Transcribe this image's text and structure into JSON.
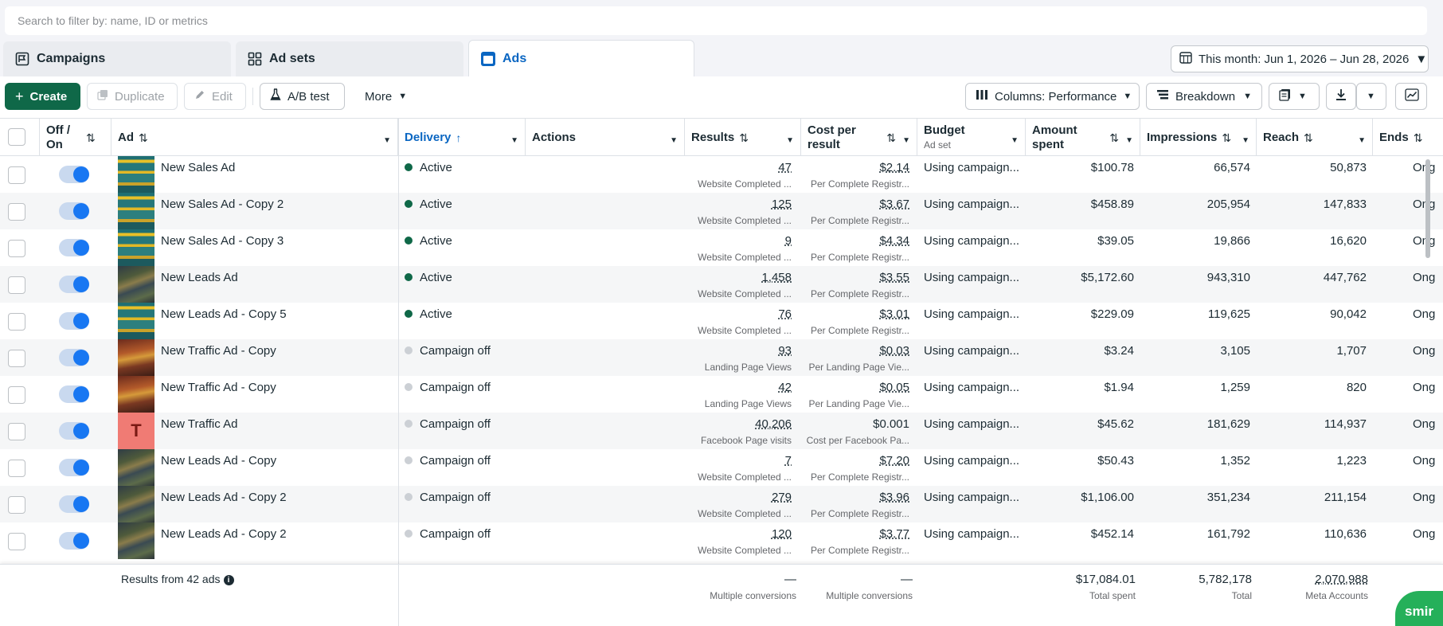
{
  "search": {
    "placeholder": "Search to filter by: name, ID or metrics"
  },
  "tabs": [
    {
      "label": "Campaigns",
      "icon": "flag-icon"
    },
    {
      "label": "Ad sets",
      "icon": "grid-icon"
    },
    {
      "label": "Ads",
      "icon": "ad-icon"
    }
  ],
  "date_range": {
    "label": "This month: Jun 1, 2026 – Jun 28, 2026"
  },
  "toolbar": {
    "create": "Create",
    "duplicate": "Duplicate",
    "edit": "Edit",
    "ab_test": "A/B test",
    "more": "More",
    "columns": "Columns: Performance",
    "breakdown": "Breakdown"
  },
  "columns": {
    "offon": "Off / On",
    "ad": "Ad",
    "delivery": "Delivery",
    "actions": "Actions",
    "results": "Results",
    "cost_per_result_1": "Cost per",
    "cost_per_result_2": "result",
    "budget": "Budget",
    "budget_sub": "Ad set",
    "amount_spent_1": "Amount",
    "amount_spent_2": "spent",
    "impressions": "Impressions",
    "reach": "Reach",
    "ends": "Ends"
  },
  "rows": [
    {
      "name": "New Sales Ad",
      "thumb": "teal",
      "delivery": "Active",
      "status": "on",
      "results": "47",
      "results_sub": "Website Completed ...",
      "cpr": "$2.14",
      "cpr_sub": "Per Complete Registr...",
      "budget": "Using campaign...",
      "spent": "$100.78",
      "impressions": "66,574",
      "reach": "50,873",
      "ends": "Ong"
    },
    {
      "name": "New Sales Ad - Copy 2",
      "thumb": "teal",
      "delivery": "Active",
      "status": "on",
      "results": "125",
      "results_sub": "Website Completed ...",
      "cpr": "$3.67",
      "cpr_sub": "Per Complete Registr...",
      "budget": "Using campaign...",
      "spent": "$458.89",
      "impressions": "205,954",
      "reach": "147,833",
      "ends": "Ong"
    },
    {
      "name": "New Sales Ad - Copy 3",
      "thumb": "teal",
      "delivery": "Active",
      "status": "on",
      "results": "9",
      "results_sub": "Website Completed ...",
      "cpr": "$4.34",
      "cpr_sub": "Per Complete Registr...",
      "budget": "Using campaign...",
      "spent": "$39.05",
      "impressions": "19,866",
      "reach": "16,620",
      "ends": "Ong"
    },
    {
      "name": "New Leads Ad",
      "thumb": "dark",
      "delivery": "Active",
      "status": "on",
      "results": "1,458",
      "results_sub": "Website Completed ...",
      "cpr": "$3.55",
      "cpr_sub": "Per Complete Registr...",
      "budget": "Using campaign...",
      "spent": "$5,172.60",
      "impressions": "943,310",
      "reach": "447,762",
      "ends": "Ong"
    },
    {
      "name": "New Leads Ad - Copy 5",
      "thumb": "teal",
      "delivery": "Active",
      "status": "on",
      "results": "76",
      "results_sub": "Website Completed ...",
      "cpr": "$3.01",
      "cpr_sub": "Per Complete Registr...",
      "budget": "Using campaign...",
      "spent": "$229.09",
      "impressions": "119,625",
      "reach": "90,042",
      "ends": "Ong"
    },
    {
      "name": "New Traffic Ad - Copy",
      "thumb": "red",
      "delivery": "Campaign off",
      "status": "off",
      "results": "93",
      "results_sub": "Landing Page Views",
      "cpr": "$0.03",
      "cpr_sub": "Per Landing Page Vie...",
      "budget": "Using campaign...",
      "spent": "$3.24",
      "impressions": "3,105",
      "reach": "1,707",
      "ends": "Ong"
    },
    {
      "name": "New Traffic Ad - Copy",
      "thumb": "red",
      "delivery": "Campaign off",
      "status": "off",
      "results": "42",
      "results_sub": "Landing Page Views",
      "cpr": "$0.05",
      "cpr_sub": "Per Landing Page Vie...",
      "budget": "Using campaign...",
      "spent": "$1.94",
      "impressions": "1,259",
      "reach": "820",
      "ends": "Ong"
    },
    {
      "name": "New Traffic Ad",
      "thumb": "letter",
      "thumb_letter": "T",
      "delivery": "Campaign off",
      "status": "off",
      "results": "40,206",
      "results_sub": "Facebook Page visits",
      "cpr": "$0.001",
      "cpr_sub": "Cost per Facebook Pa...",
      "budget": "Using campaign...",
      "spent": "$45.62",
      "impressions": "181,629",
      "reach": "114,937",
      "ends": "Ong"
    },
    {
      "name": "New Leads Ad - Copy",
      "thumb": "dark",
      "delivery": "Campaign off",
      "status": "off",
      "results": "7",
      "results_sub": "Website Completed ...",
      "cpr": "$7.20",
      "cpr_sub": "Per Complete Registr...",
      "budget": "Using campaign...",
      "spent": "$50.43",
      "impressions": "1,352",
      "reach": "1,223",
      "ends": "Ong"
    },
    {
      "name": "New Leads Ad - Copy 2",
      "thumb": "dark",
      "delivery": "Campaign off",
      "status": "off",
      "results": "279",
      "results_sub": "Website Completed ...",
      "cpr": "$3.96",
      "cpr_sub": "Per Complete Registr...",
      "budget": "Using campaign...",
      "spent": "$1,106.00",
      "impressions": "351,234",
      "reach": "211,154",
      "ends": "Ong"
    },
    {
      "name": "New Leads Ad - Copy 2",
      "thumb": "dark",
      "delivery": "Campaign off",
      "status": "off",
      "results": "120",
      "results_sub": "Website Completed ...",
      "cpr": "$3.77",
      "cpr_sub": "Per Complete Registr...",
      "budget": "Using campaign...",
      "spent": "$452.14",
      "impressions": "161,792",
      "reach": "110,636",
      "ends": "Ong"
    }
  ],
  "footer": {
    "summary": "Results from 42 ads",
    "results": "—",
    "results_sub": "Multiple conversions",
    "cpr": "—",
    "cpr_sub": "Multiple conversions",
    "spent": "$17,084.01",
    "spent_sub": "Total spent",
    "impressions": "5,782,178",
    "impressions_sub": "Total",
    "reach": "2,070,988",
    "reach_sub": "Meta Accounts"
  },
  "badge": {
    "label": "smir"
  },
  "colors": {
    "primary_green": "#0f6848",
    "accent_blue": "#1877f2",
    "link_blue": "#0a66c2",
    "badge_green": "#25b05a"
  }
}
